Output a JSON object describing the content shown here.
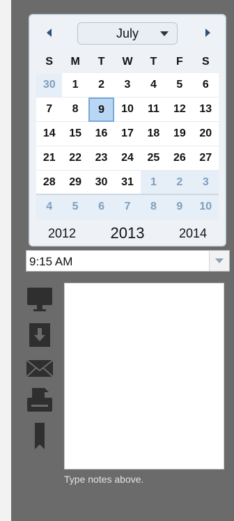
{
  "calendar": {
    "month": "July",
    "weekdays": [
      "S",
      "M",
      "T",
      "W",
      "T",
      "F",
      "S"
    ],
    "days": [
      {
        "label": "30",
        "other": true
      },
      {
        "label": "1"
      },
      {
        "label": "2"
      },
      {
        "label": "3"
      },
      {
        "label": "4"
      },
      {
        "label": "5"
      },
      {
        "label": "6"
      },
      {
        "label": "7"
      },
      {
        "label": "8"
      },
      {
        "label": "9",
        "selected": true
      },
      {
        "label": "10"
      },
      {
        "label": "11"
      },
      {
        "label": "12"
      },
      {
        "label": "13"
      },
      {
        "label": "14"
      },
      {
        "label": "15"
      },
      {
        "label": "16"
      },
      {
        "label": "17"
      },
      {
        "label": "18"
      },
      {
        "label": "19"
      },
      {
        "label": "20"
      },
      {
        "label": "21"
      },
      {
        "label": "22"
      },
      {
        "label": "23"
      },
      {
        "label": "24"
      },
      {
        "label": "25"
      },
      {
        "label": "26"
      },
      {
        "label": "27"
      },
      {
        "label": "28"
      },
      {
        "label": "29"
      },
      {
        "label": "30"
      },
      {
        "label": "31"
      },
      {
        "label": "1",
        "other": true
      },
      {
        "label": "2",
        "other": true
      },
      {
        "label": "3",
        "other": true
      },
      {
        "label": "4",
        "other": true
      },
      {
        "label": "5",
        "other": true
      },
      {
        "label": "6",
        "other": true
      },
      {
        "label": "7",
        "other": true
      },
      {
        "label": "8",
        "other": true
      },
      {
        "label": "9",
        "other": true
      },
      {
        "label": "10",
        "other": true
      }
    ],
    "years": {
      "prev": "2012",
      "current": "2013",
      "next": "2014"
    }
  },
  "time": {
    "value": "9:15 AM"
  },
  "icons": [
    "monitor-icon",
    "download-icon",
    "mail-icon",
    "print-icon",
    "bookmark-icon"
  ],
  "notes": {
    "value": "",
    "hint": "Type notes above."
  },
  "colors": {
    "accent": "#b9d7f4",
    "panel": "#6b6b6b"
  }
}
